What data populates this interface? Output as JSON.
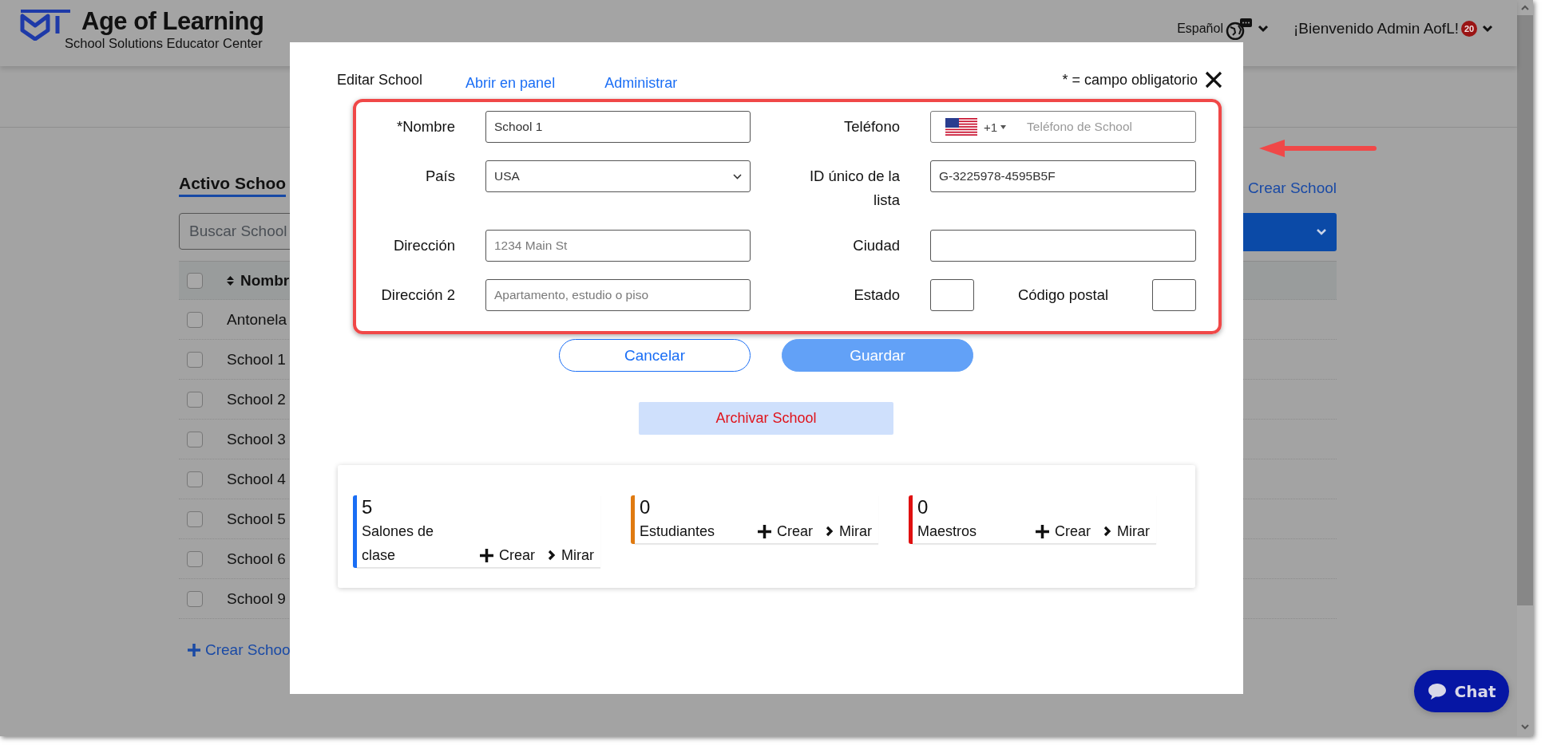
{
  "header": {
    "logo_title": "Age of Learning",
    "logo_subtitle": "School Solutions Educator Center",
    "language": "Español",
    "welcome": "¡Bienvenido Admin AofL!",
    "notification_count": "20"
  },
  "background_page": {
    "heading": "Activo Schoo",
    "create_link_right": "Crear School",
    "search": {
      "placeholder": "Buscar School"
    },
    "table": {
      "all_checked": false,
      "columns": [
        "Nombr"
      ],
      "rows": [
        {
          "name": "Antonela",
          "checked": false
        },
        {
          "name": "School 1",
          "checked": false
        },
        {
          "name": "School 2",
          "checked": false
        },
        {
          "name": "School 3",
          "checked": false
        },
        {
          "name": "School 4",
          "checked": false
        },
        {
          "name": "School 5",
          "checked": false
        },
        {
          "name": "School 6",
          "checked": false
        },
        {
          "name": "School 9",
          "checked": false
        }
      ]
    },
    "create_link": "Crear Schoo"
  },
  "modal": {
    "title": "Editar School",
    "links": [
      "Abrir en panel",
      "Administrar"
    ],
    "required_note": "* = campo obligatorio",
    "fields": [
      {
        "label": "*Nombre",
        "kind": "text",
        "value": "School 1"
      },
      {
        "label": "Teléfono",
        "kind": "phone",
        "dial_code": "+1",
        "placeholder": "Teléfono de School"
      },
      {
        "label": "País",
        "kind": "select",
        "value": "USA"
      },
      {
        "label": "ID único de la lista",
        "kind": "text",
        "value": "G-3225978-4595B5F"
      },
      {
        "label": "Dirección",
        "kind": "text",
        "placeholder": "1234 Main St"
      },
      {
        "label": "Ciudad",
        "kind": "text"
      },
      {
        "label": "Dirección 2",
        "kind": "text",
        "placeholder": "Apartamento, estudio o piso"
      },
      {
        "label": "Estado",
        "kind": "short"
      },
      {
        "label": "Código postal",
        "kind": "short"
      }
    ],
    "buttons": [
      {
        "label": "Cancelar",
        "kind": "secondary",
        "disabled": false
      },
      {
        "label": "Guardar",
        "kind": "primary",
        "disabled": true
      }
    ],
    "archive_button": "Archivar School",
    "stats": [
      {
        "count": "5",
        "label": "Salones de clase",
        "color": "#1a6ef5",
        "actions": [
          "Crear",
          "Mirar"
        ]
      },
      {
        "count": "0",
        "label": "Estudiantes",
        "color": "#e07a10",
        "actions": [
          "Crear",
          "Mirar"
        ]
      },
      {
        "count": "0",
        "label": "Maestros",
        "color": "#e01010",
        "actions": [
          "Crear",
          "Mirar"
        ]
      }
    ]
  },
  "chat_button": "Chat"
}
